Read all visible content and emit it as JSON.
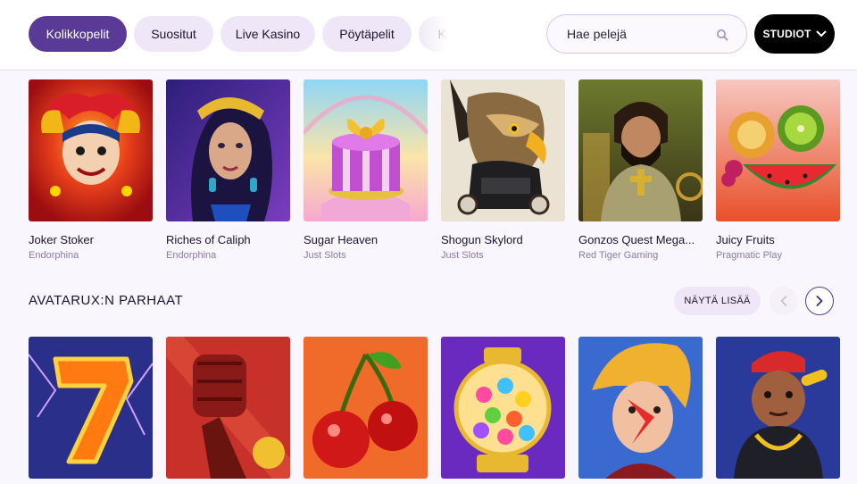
{
  "tabs": [
    {
      "label": "Kolikkopelit",
      "active": true
    },
    {
      "label": "Suositut",
      "active": false
    },
    {
      "label": "Live Kasino",
      "active": false
    },
    {
      "label": "Pöytäpelit",
      "active": false
    },
    {
      "label": "Ko",
      "active": false
    }
  ],
  "search": {
    "placeholder": "Hae pelejä",
    "icon": "search-icon"
  },
  "studios_button": {
    "label": "STUDIOT",
    "icon": "chevron-down-icon"
  },
  "row1_games": [
    {
      "name": "Joker Stoker",
      "provider": "Endorphina"
    },
    {
      "name": "Riches of Caliph",
      "provider": "Endorphina"
    },
    {
      "name": "Sugar Heaven",
      "provider": "Just Slots"
    },
    {
      "name": "Shogun Skylord",
      "provider": "Just Slots"
    },
    {
      "name": "Gonzos Quest Mega...",
      "provider": "Red Tiger Gaming"
    },
    {
      "name": "Juicy Fruits",
      "provider": "Pragmatic Play"
    }
  ],
  "section": {
    "title": "AVATARUX:N PARHAAT",
    "show_more_label": "NÄYTÄ LISÄÄ",
    "prev_icon": "chevron-left-icon",
    "next_icon": "chevron-right-icon"
  },
  "row2_thumbnails": [
    "lucky-seven",
    "fist",
    "cherries",
    "gumball-machine",
    "rock-star",
    "gold-chain-character"
  ],
  "colors": {
    "accent": "#5a3a97",
    "tab_bg": "#efe7f7",
    "provider_text": "#8c7aa6"
  }
}
